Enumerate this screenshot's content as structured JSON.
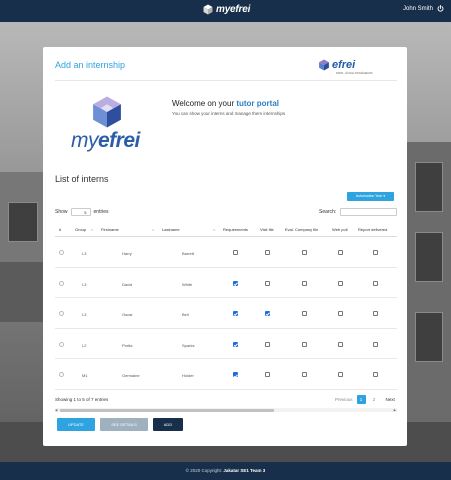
{
  "topbar": {
    "logo_text": "myefrei",
    "user_name": "John Smith",
    "power_icon": "power-icon"
  },
  "card": {
    "title": "Add an internship",
    "efrei_logo_text": "efrei",
    "efrei_logo_sub": "PARIS · ÉCOLE D'INGÉNIEURS",
    "big_logo_my": "my",
    "big_logo_efrei": "efrei",
    "welcome_prefix": "Welcome on your ",
    "welcome_highlight": "tutor portal",
    "welcome_sub": "You can show your interns and manage them internships"
  },
  "list": {
    "title": "List of interns",
    "internship_button": "Autorisation Year ▾",
    "show_label": "Show",
    "entries_value": "5",
    "entries_label": "entries",
    "search_label": "Search:",
    "search_placeholder": ""
  },
  "table": {
    "headers": [
      "#",
      "Group",
      "Firstname",
      "Lastname",
      "Requirements",
      "Visit file",
      "Eval. Company file",
      "Web poll",
      "Report delivered"
    ],
    "rows": [
      {
        "group": "L3",
        "firstname": "Harry",
        "lastname": "Barrett",
        "checks": [
          false,
          false,
          false,
          false,
          false
        ]
      },
      {
        "group": "L3",
        "firstname": "David",
        "lastname": "White",
        "checks": [
          true,
          false,
          false,
          false,
          false
        ]
      },
      {
        "group": "L3",
        "firstname": "Oscar",
        "lastname": "Bell",
        "checks": [
          true,
          true,
          false,
          false,
          false
        ]
      },
      {
        "group": "L2",
        "firstname": "Portia",
        "lastname": "Sparks",
        "checks": [
          true,
          false,
          false,
          false,
          false
        ]
      },
      {
        "group": "M1",
        "firstname": "Germaine",
        "lastname": "Holder",
        "checks": [
          true,
          false,
          false,
          false,
          false
        ]
      }
    ]
  },
  "pagination": {
    "showing": "Showing 1 to 5 of 7 entries",
    "previous": "Previous",
    "pages": [
      "1",
      "2"
    ],
    "active_page": "1",
    "next": "Next"
  },
  "actions": {
    "update": "UPDATE",
    "details": "SEE DETAILS",
    "add": "ADD"
  },
  "footer": {
    "copyright": "© 2020 Copyright: ",
    "team": "Jakatar SE1 Team 3"
  },
  "colors": {
    "navbar": "#172f4a",
    "accent": "#2ea3df",
    "checkbox_checked": "#1e6fd9"
  }
}
